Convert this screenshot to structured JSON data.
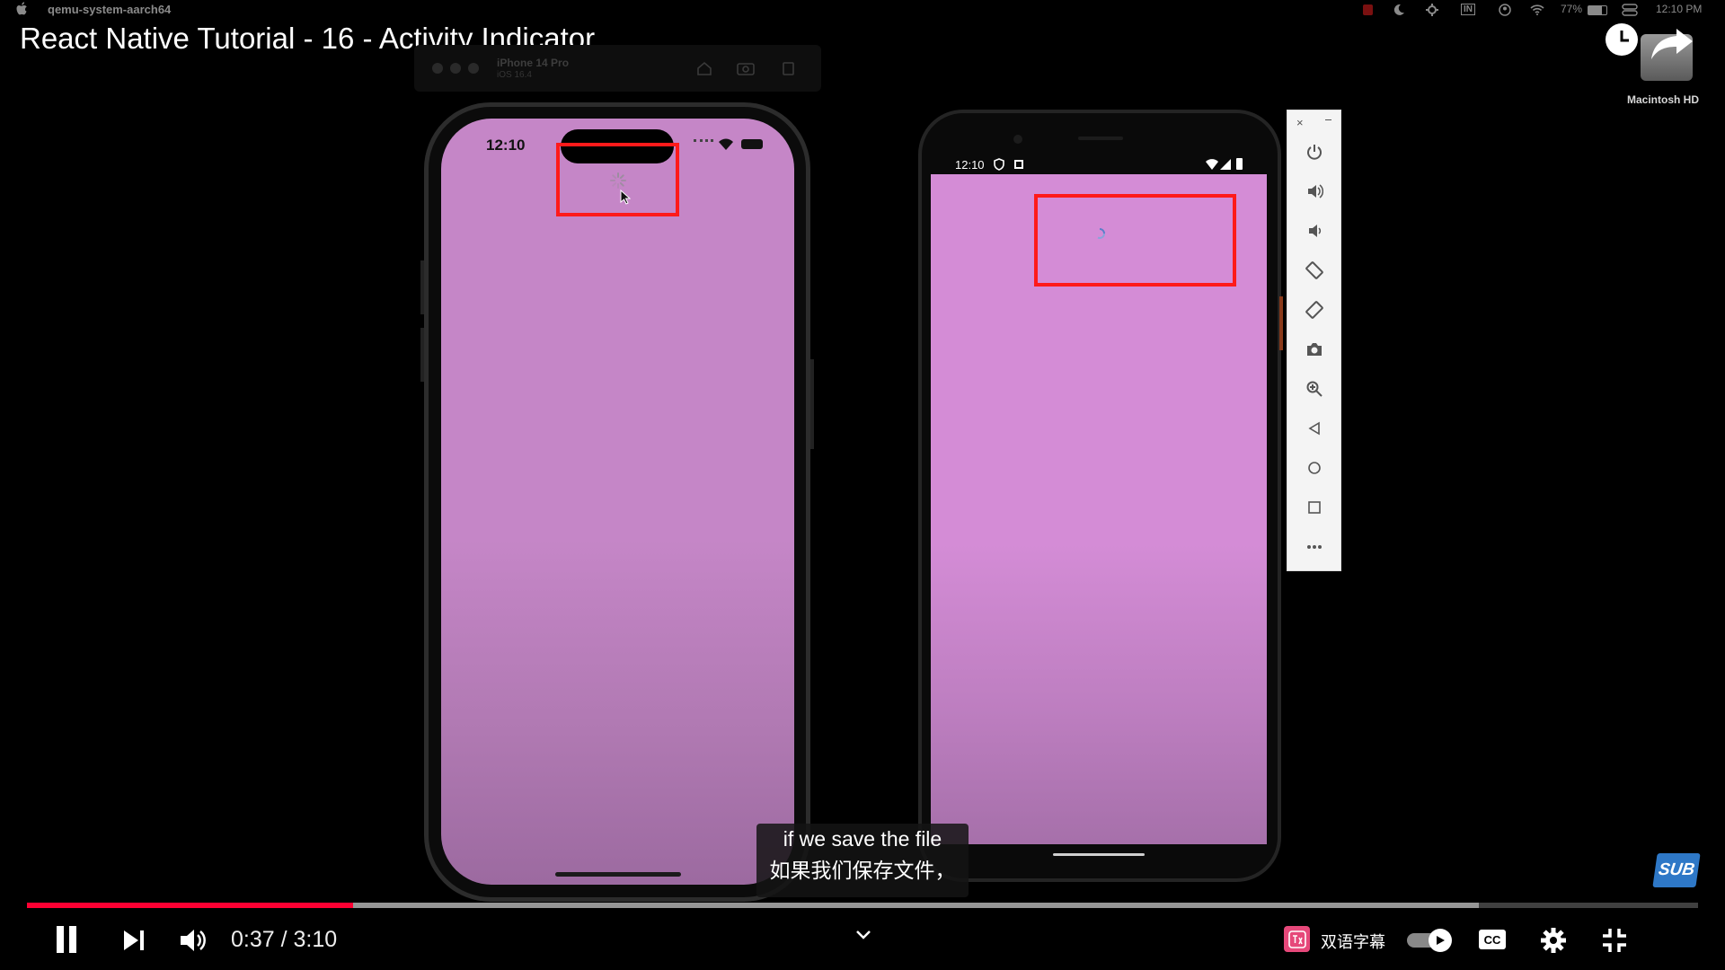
{
  "menubar": {
    "app_name": "qemu-system-aarch64",
    "battery_percent": "77%",
    "clock": "12:10 PM",
    "keyboard_badge": "IN"
  },
  "video": {
    "title": "React Native Tutorial - 16 - Activity Indicator",
    "current_time": "0:37",
    "duration": "3:10",
    "time_display": "0:37 / 3:10",
    "progress_fraction": 0.195,
    "buffered_fraction": 0.869
  },
  "simulator": {
    "device_name": "iPhone 14 Pro",
    "os_version": "iOS 16.4"
  },
  "desktop": {
    "disk_label": "Macintosh HD"
  },
  "ios_phone": {
    "time": "12:10",
    "background_color": "#c586c7"
  },
  "android_phone": {
    "time": "12:10",
    "background_color": "#d48cd6"
  },
  "emulator_controls": [
    "power-icon",
    "volume-up-icon",
    "volume-down-icon",
    "rotate-left-icon",
    "rotate-right-icon",
    "camera-icon",
    "zoom-icon",
    "back-icon",
    "home-icon",
    "overview-icon",
    "more-icon"
  ],
  "subtitles": {
    "line_en": "if we save the file",
    "line_zh": "如果我们保存文件，"
  },
  "extension": {
    "bilingual_label": "双语字幕",
    "sub_badge": "SUB"
  },
  "colors": {
    "progress": "#ff0033",
    "highlight_box": "#ff1a1a"
  }
}
